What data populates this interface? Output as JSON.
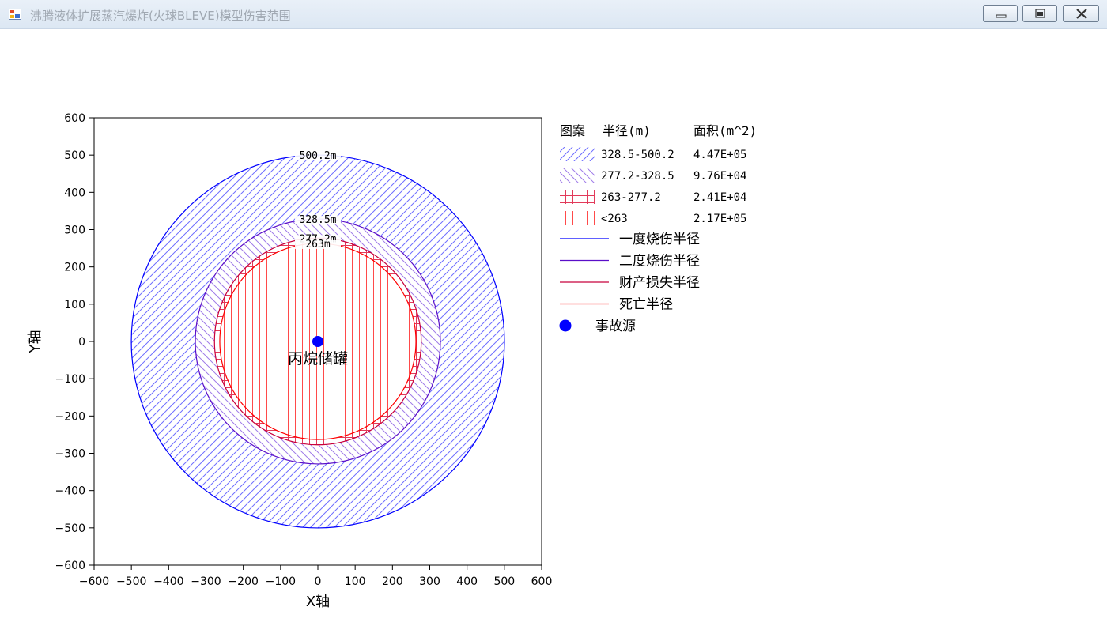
{
  "window": {
    "title": "沸腾液体扩展蒸汽爆炸(火球BLEVE)模型伤害范围",
    "icon": "app-window-icon",
    "controls": [
      "minimize-icon",
      "maximize-icon",
      "close-icon"
    ]
  },
  "chart_data": {
    "type": "scatter",
    "xlabel": "X轴",
    "ylabel": "Y轴",
    "xlim": [
      -600,
      600
    ],
    "ylim": [
      -600,
      600
    ],
    "xticks": [
      -600,
      -500,
      -400,
      -300,
      -200,
      -100,
      0,
      100,
      200,
      300,
      400,
      500,
      600
    ],
    "yticks": [
      600,
      500,
      400,
      300,
      200,
      100,
      0,
      -100,
      -200,
      -300,
      -400,
      -500,
      -600
    ],
    "grid": false,
    "legend_position": "right-outside",
    "circles": [
      {
        "name": "一度烧伤半径",
        "radius": 500.2,
        "label": "500.2m",
        "color": "#0000ff"
      },
      {
        "name": "二度烧伤半径",
        "radius": 328.5,
        "label": "328.5m",
        "color": "#5a0ec8"
      },
      {
        "name": "财产损失半径",
        "radius": 277.2,
        "label": "277.2m",
        "color": "#c8003c"
      },
      {
        "name": "死亡半径",
        "radius": 263,
        "label": "263m",
        "color": "#ff0000"
      }
    ],
    "rings": [
      {
        "pattern": "diag-forward",
        "range": "328.5-500.2",
        "area": "4.47E+05",
        "color": "#6f6fff"
      },
      {
        "pattern": "diag-back",
        "range": "277.2-328.5",
        "area": "9.76E+04",
        "color": "#a07ce8"
      },
      {
        "pattern": "grid",
        "range": "263-277.2",
        "area": "2.41E+04",
        "color": "#e23a5a"
      },
      {
        "pattern": "vertical",
        "range": "<263",
        "area": "2.17E+05",
        "color": "#ff4a4a"
      }
    ],
    "source": {
      "x": 0,
      "y": 0,
      "name": "事故源",
      "label": "丙烷储罐",
      "color": "#0000ff"
    },
    "legend": {
      "header_pattern": "图案",
      "header_radius": "半径(m)",
      "header_area": "面积(m^2)"
    }
  }
}
